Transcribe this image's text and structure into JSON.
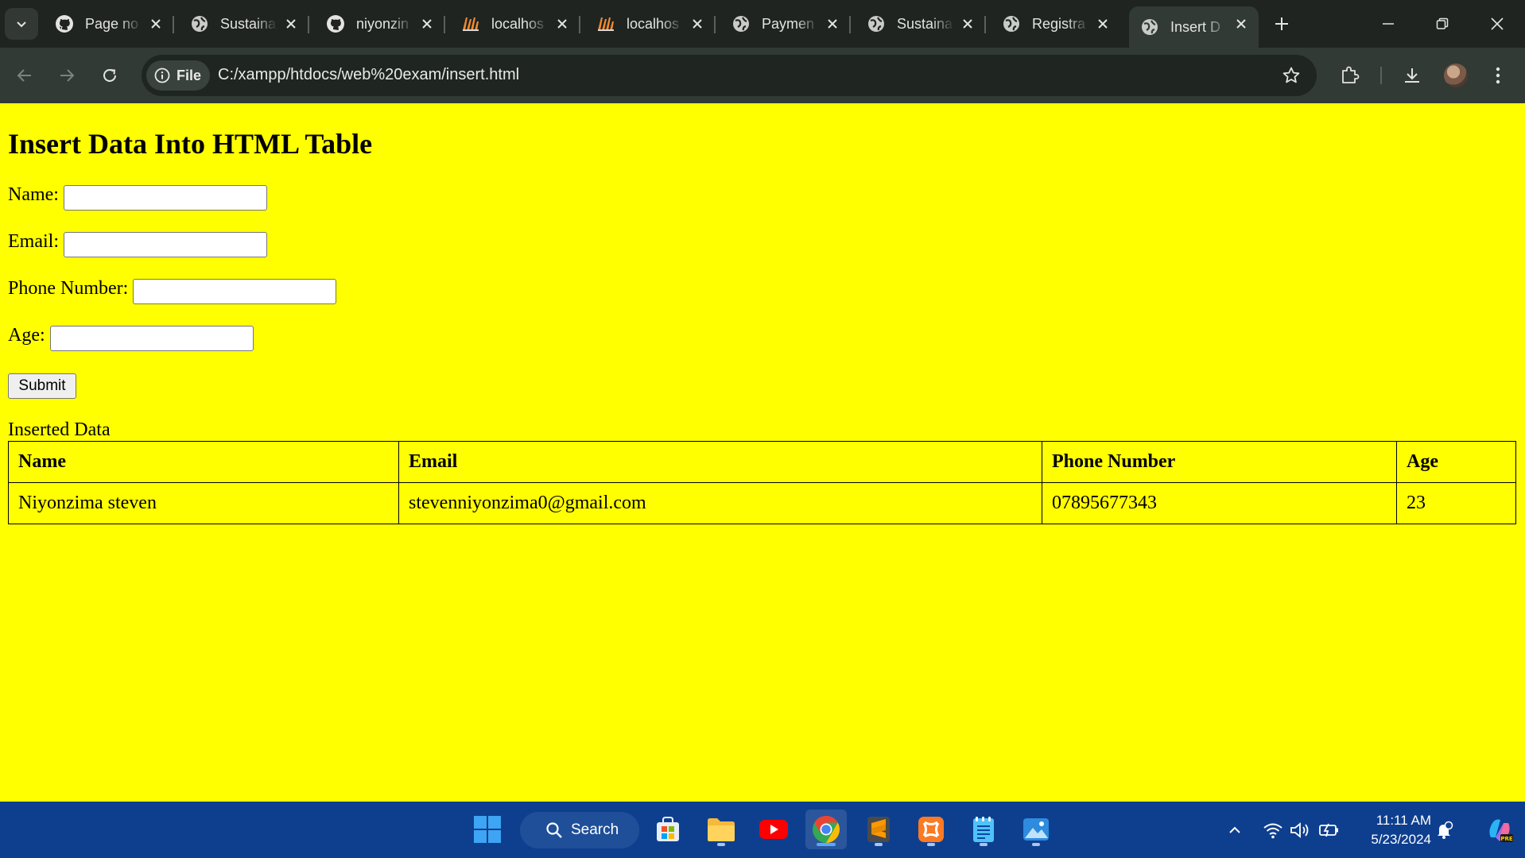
{
  "browser": {
    "tabs": [
      {
        "title": "Page no",
        "favicon": "github-icon"
      },
      {
        "title": "Sustaina",
        "favicon": "globe-icon"
      },
      {
        "title": "niyonzin",
        "favicon": "github-icon"
      },
      {
        "title": "localhos",
        "favicon": "xampp-icon"
      },
      {
        "title": "localhos",
        "favicon": "xampp-icon"
      },
      {
        "title": "Paymen",
        "favicon": "globe-icon"
      },
      {
        "title": "Sustaina",
        "favicon": "globe-icon"
      },
      {
        "title": "Registra",
        "favicon": "globe-icon"
      },
      {
        "title": "Insert D",
        "favicon": "globe-icon",
        "active": true
      }
    ],
    "site_chip": "File",
    "url": "C:/xampp/htdocs/web%20exam/insert.html"
  },
  "page": {
    "heading": "Insert Data Into HTML Table",
    "form": {
      "name_label": "Name:",
      "email_label": "Email:",
      "phone_label": "Phone Number:",
      "age_label": "Age:",
      "name_value": "",
      "email_value": "",
      "phone_value": "",
      "age_value": "",
      "submit_label": "Submit"
    },
    "table": {
      "caption": "Inserted Data",
      "headers": [
        "Name",
        "Email",
        "Phone Number",
        "Age"
      ],
      "rows": [
        [
          "Niyonzima steven",
          "stevenniyonzima0@gmail.com",
          "07895677343",
          "23"
        ]
      ]
    }
  },
  "taskbar": {
    "search_label": "Search",
    "apps": [
      "start-icon",
      "microsoft-store-icon",
      "file-explorer-icon",
      "youtube-icon",
      "chrome-icon",
      "sublime-text-icon",
      "xampp-icon",
      "notepad-icon",
      "photos-icon"
    ],
    "time": "11:11 AM",
    "date": "5/23/2024"
  },
  "colors": {
    "page_background": "#ffff00",
    "browser_frame": "#1f2420",
    "toolbar": "#313a35",
    "taskbar": "#0e3f8f"
  }
}
